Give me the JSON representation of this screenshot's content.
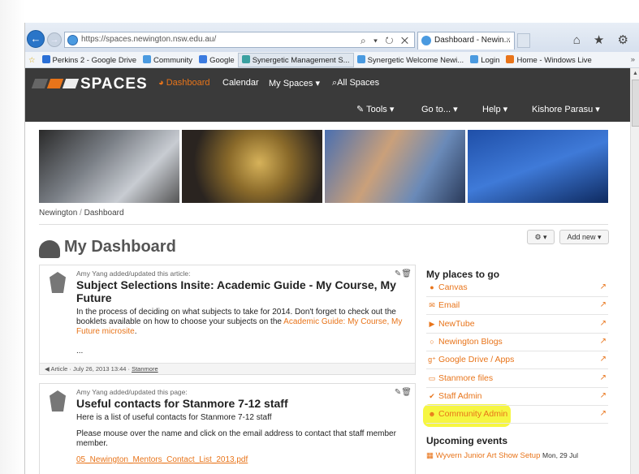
{
  "browser": {
    "url": "https://spaces.newington.nsw.edu.au/",
    "tab_title": "Dashboard - Newin...",
    "tab_close": "×",
    "url_tools": "⌕ ▾ ↻ ✕",
    "right_icons": "⌂ ★ ⚙",
    "favorites": [
      {
        "label": "Perkins 2 - Google Drive",
        "color": "#2a6fd6"
      },
      {
        "label": "Community",
        "color": "#4a9ae0"
      },
      {
        "label": "Google",
        "color": "#3b7be0"
      },
      {
        "label": "Synergetic Management S...",
        "color": "#3aa0a0"
      },
      {
        "label": "Synergetic Welcome Newi...",
        "color": "#4a9ae0"
      },
      {
        "label": "Login",
        "color": "#4a9ae0"
      },
      {
        "label": "Home - Windows Live",
        "color": "#e8741a"
      }
    ],
    "fav_more": "»"
  },
  "nav": {
    "logo": "SPACES",
    "dashboard": "Dashboard",
    "calendar": "Calendar",
    "my_spaces": "My Spaces ▾",
    "all_spaces": "All Spaces",
    "tools": "Tools ▾",
    "goto": "Go to... ▾",
    "help": "Help ▾",
    "user": "Kishore Parasu ▾"
  },
  "breadcrumb": {
    "home": "Newington",
    "sep": "/",
    "current": "Dashboard"
  },
  "page": {
    "title": "My Dashboard",
    "gear_btn": "⚙ ▾",
    "add_new": "Add new ▾"
  },
  "cards": [
    {
      "meta": "Amy Yang added/updated this article:",
      "title": "Subject Selections Insite: Academic Guide - My Course, My Future",
      "body_pre": "In the process of deciding on what subjects to take for 2014. Don't forget to check out the booklets available on how to choose your subjects on the ",
      "body_link": "Academic Guide: My Course, My Future microsite",
      "body_post": ".",
      "ellipsis": "...",
      "foot": "Article · July 26, 2013 13:44 · ",
      "foot_link": "Stanmore"
    },
    {
      "meta": "Amy Yang added/updated this page:",
      "title": "Useful contacts for Stanmore 7-12 staff",
      "body1": "Here is a list of useful contacts for Stanmore 7-12 staff",
      "body2": "Please mouse over the name and click on the email address to contact that staff member member.",
      "file_link": "05_Newington_Mentors_Contact_List_2013.pdf"
    }
  ],
  "places": {
    "heading": "My places to go",
    "items": [
      {
        "label": "Canvas",
        "icon": "●"
      },
      {
        "label": "Email",
        "icon": "✉"
      },
      {
        "label": "NewTube",
        "icon": "▶"
      },
      {
        "label": "Newington Blogs",
        "icon": "○"
      },
      {
        "label": "Google Drive / Apps",
        "icon": "g⁺"
      },
      {
        "label": "Stanmore files",
        "icon": "▭"
      },
      {
        "label": "Staff Admin",
        "icon": "✔"
      },
      {
        "label": "Community Admin",
        "icon": "☻"
      }
    ],
    "ext_icon": "↗"
  },
  "events": {
    "heading": "Upcoming events",
    "items": [
      {
        "label": "Wyvern Junior Art Show Setup",
        "date": "Mon, 29 Jul"
      }
    ]
  }
}
